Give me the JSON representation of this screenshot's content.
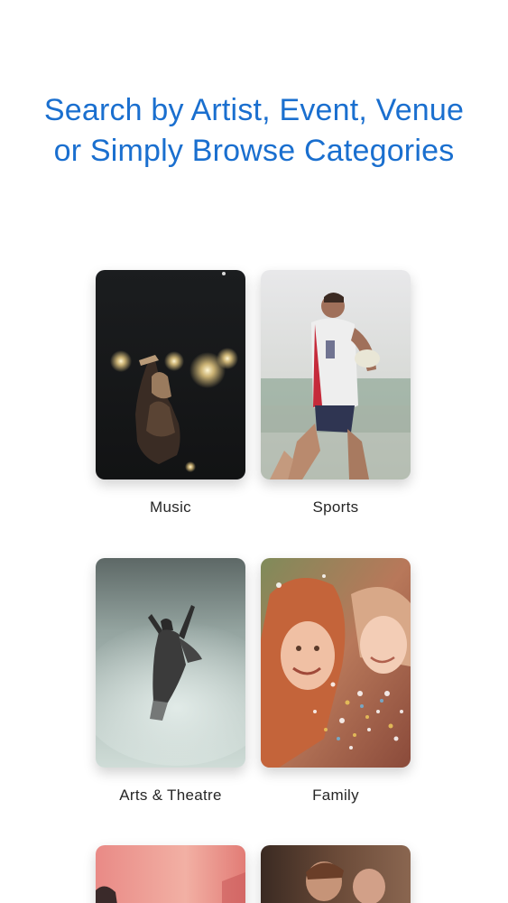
{
  "header": {
    "title_line1": "Search by Artist, Event, Venue",
    "title_line2": "or Simply Browse Categories"
  },
  "categories": [
    {
      "label": "Music"
    },
    {
      "label": "Sports"
    },
    {
      "label": "Arts & Theatre"
    },
    {
      "label": "Family"
    }
  ],
  "colors": {
    "accent": "#1a6fcf",
    "label_text": "#262626",
    "background": "#ffffff"
  }
}
